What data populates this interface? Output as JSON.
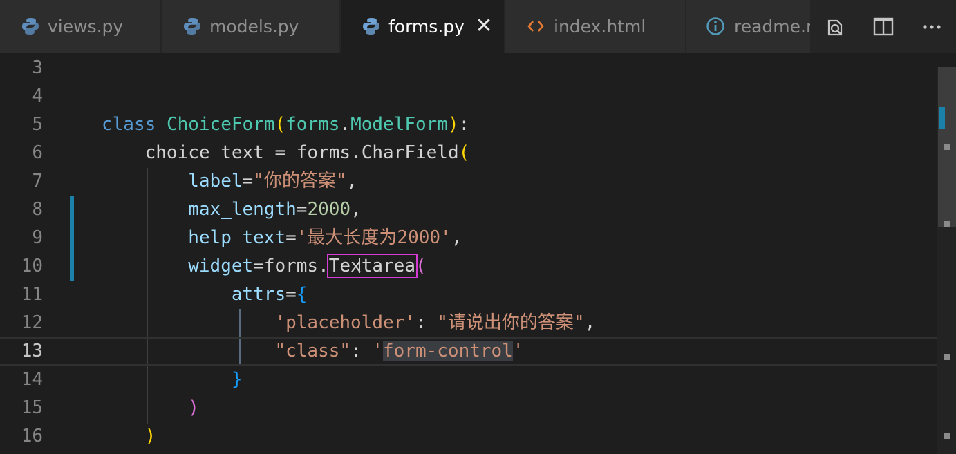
{
  "tabs": [
    {
      "label": "views.py",
      "icon": "python-icon",
      "active": false
    },
    {
      "label": "models.py",
      "icon": "python-icon",
      "active": false
    },
    {
      "label": "forms.py",
      "icon": "python-icon",
      "active": true,
      "close": "✕"
    },
    {
      "label": "index.html",
      "icon": "html-code-icon",
      "active": false
    },
    {
      "label": "readme.r",
      "icon": "info-icon",
      "active": false
    }
  ],
  "toolbar": {
    "actions": [
      "open-preview-icon",
      "split-editor-icon",
      "more-actions-icon"
    ],
    "more_label": "···"
  },
  "editor": {
    "file": "forms.py",
    "current_line": 13,
    "highlighted_token": "Textarea",
    "line_numbers": [
      "3",
      "4",
      "5",
      "6",
      "7",
      "8",
      "9",
      "10",
      "11",
      "12",
      "13",
      "14",
      "15",
      "16"
    ],
    "code": {
      "l5": {
        "kw": "class",
        "name": "ChoiceForm",
        "open": "(",
        "mod": "forms",
        "dot": ".",
        "base": "ModelForm",
        "close": ")",
        "colon": ":"
      },
      "l6": {
        "var": "choice_text",
        "eq": " = ",
        "mod": "forms",
        "dot": ".",
        "fn": "CharField",
        "open": "("
      },
      "l7": {
        "key": "label",
        "eq": "=",
        "val": "\"你的答案\"",
        "comma": ","
      },
      "l8": {
        "key": "max_length",
        "eq": "=",
        "val": "2000",
        "comma": ","
      },
      "l9": {
        "key": "help_text",
        "eq": "=",
        "val": "'最大长度为2000'",
        "comma": ","
      },
      "l10": {
        "key": "widget",
        "eq": "=",
        "mod": "forms",
        "dot": ".",
        "fn": "Textarea",
        "open": "("
      },
      "l11": {
        "key": "attrs",
        "eq": "=",
        "open": "{"
      },
      "l12": {
        "key": "'placeholder'",
        "colon": ": ",
        "val": "\"请说出你的答案\"",
        "comma": ","
      },
      "l13": {
        "key": "\"class\"",
        "colon": ": ",
        "q1": "'",
        "val": "form-control",
        "q2": "'"
      },
      "l14": {
        "close": "}"
      },
      "l15": {
        "close": ")"
      },
      "l16": {
        "close": ")"
      }
    }
  },
  "colors": {
    "background": "#1e1e1e",
    "keyword": "#569cd6",
    "class": "#4ec9b0",
    "variable": "#9cdcfe",
    "string": "#ce9178",
    "number": "#b5cea8",
    "highlight_box": "#d53bd5",
    "modified_gutter": "#1b81a8"
  }
}
